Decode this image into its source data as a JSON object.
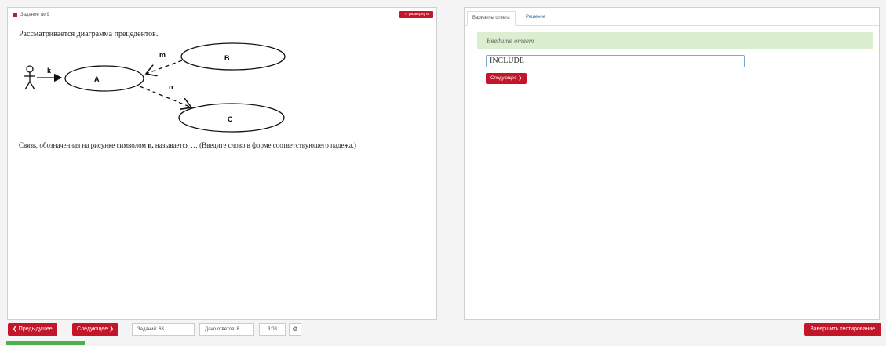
{
  "left": {
    "task_title": "Задание № 9",
    "expand_label": "⇔ развернуть",
    "question_intro": "Рассматривается диаграмма прецедентов.",
    "question_pre": "Связь, обозначенная на рисунке символом ",
    "question_symbol": "n,",
    "question_post": " называется … (Введите слово в форме соответствующего падежа.)",
    "diagram": {
      "labels": {
        "k": "k",
        "m": "m",
        "n": "n",
        "A": "A",
        "B": "B",
        "C": "C"
      }
    }
  },
  "right": {
    "tab_answers": "Варианты ответа",
    "tab_solution": "Решение",
    "banner": "Введите ответ",
    "answer_value": "INCLUDE",
    "next_label": "Следующее ❯"
  },
  "footer": {
    "prev_label": "❮ Предыдущее",
    "next_label": "Следующее ❯",
    "tasks_label": "Заданий: 68",
    "answers_label": "Дано ответов: 8",
    "timer": "3:08",
    "settings_icon": "⚙",
    "finish_label": "Завершить тестирование"
  },
  "colors": {
    "accent": "#c4162a",
    "banner_bg": "#dbeed0",
    "input_border": "#7aa7d8"
  }
}
